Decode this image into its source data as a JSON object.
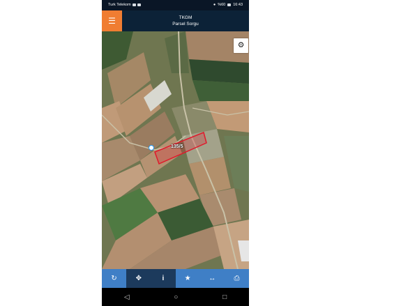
{
  "status_bar": {
    "carrier": "Turk Telekom",
    "battery": "%60",
    "time": "16:43"
  },
  "app_bar": {
    "title": "TKGM",
    "subtitle": "Parsel Sorgu",
    "menu_icon": "☰"
  },
  "map": {
    "parcel_label": "135/5",
    "settings_icon": "gear-icon"
  },
  "toolbar": {
    "items": [
      {
        "icon": "refresh-icon",
        "glyph": "↻"
      },
      {
        "icon": "locate-icon",
        "glyph": "✥"
      },
      {
        "icon": "info-icon",
        "glyph": "i"
      },
      {
        "icon": "star-icon",
        "glyph": "★"
      },
      {
        "icon": "measure-icon",
        "glyph": "↔"
      },
      {
        "icon": "print-icon",
        "glyph": "⎙"
      }
    ]
  },
  "nav_bar": {
    "back": "◁",
    "home": "○",
    "recents": "□"
  },
  "colors": {
    "accent": "#f07d32",
    "toolbar_blue": "#3f7fc6",
    "toolbar_dark": "#1c3a5c",
    "parcel_outline": "#e0192b"
  }
}
